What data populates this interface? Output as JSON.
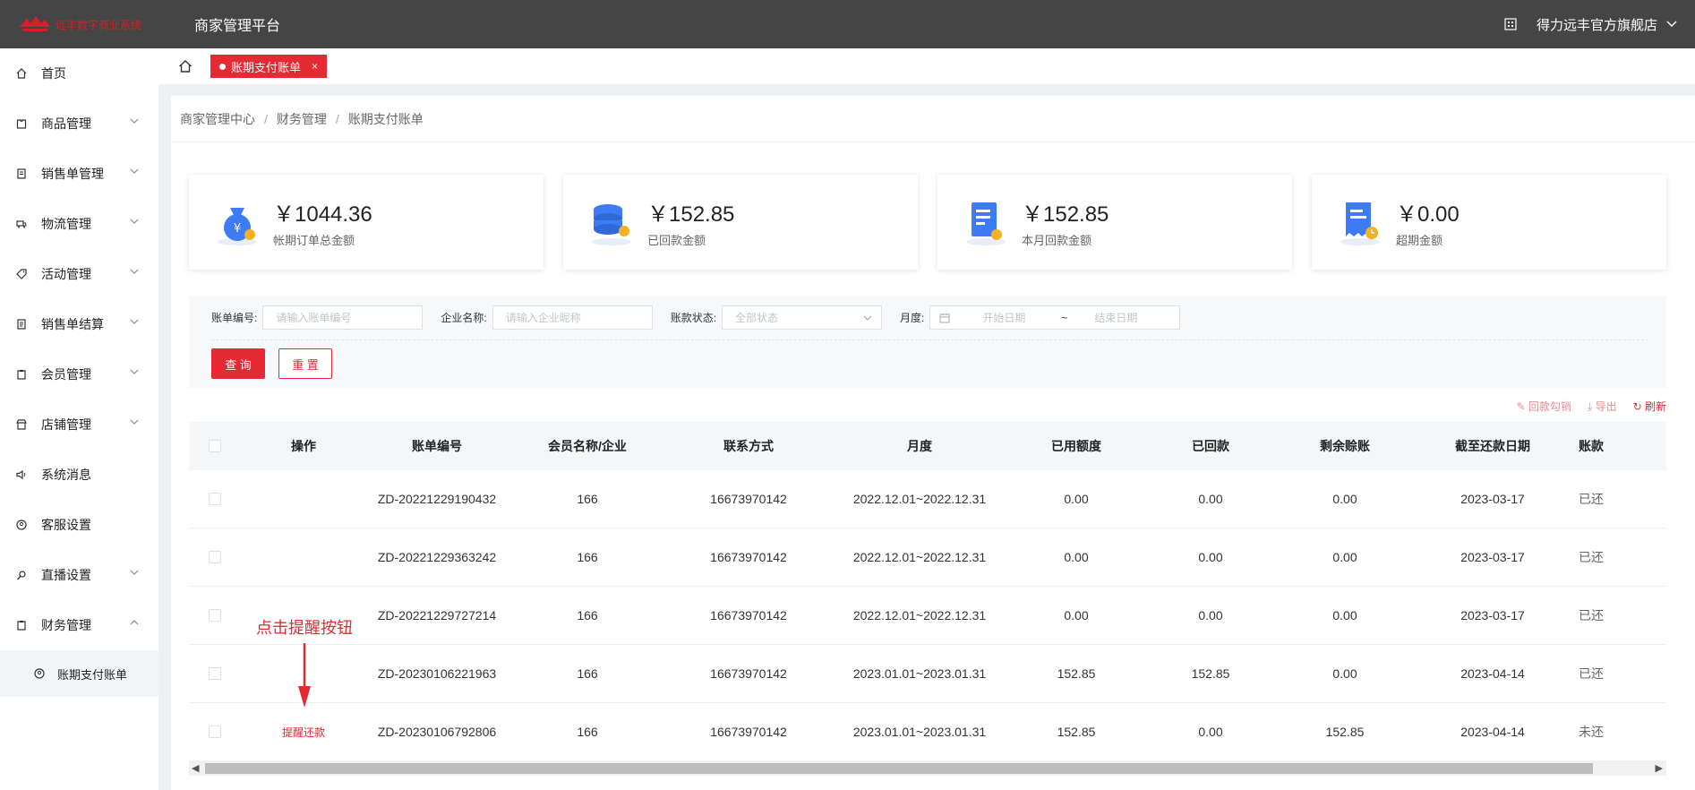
{
  "header": {
    "logo_text": "远丰数字商业系统",
    "platform_title": "商家管理平台",
    "store_name": "得力远丰官方旗舰店"
  },
  "sidebar": {
    "items": [
      {
        "label": "首页",
        "icon": "home-icon"
      },
      {
        "label": "商品管理",
        "icon": "goods-icon"
      },
      {
        "label": "销售单管理",
        "icon": "order-icon"
      },
      {
        "label": "物流管理",
        "icon": "truck-icon"
      },
      {
        "label": "活动管理",
        "icon": "tag-icon"
      },
      {
        "label": "销售单结算",
        "icon": "settle-icon"
      },
      {
        "label": "会员管理",
        "icon": "member-icon"
      },
      {
        "label": "店铺管理",
        "icon": "shop-icon"
      },
      {
        "label": "系统消息",
        "icon": "speaker-icon"
      },
      {
        "label": "客服设置",
        "icon": "service-icon"
      },
      {
        "label": "直播设置",
        "icon": "live-icon"
      },
      {
        "label": "财务管理",
        "icon": "finance-icon"
      }
    ],
    "sub_item": "账期支付账单"
  },
  "tabs": {
    "active_label": "账期支付账单",
    "close": "×"
  },
  "breadcrumb": [
    "商家管理中心",
    "财务管理",
    "账期支付账单"
  ],
  "breadcrumb_sep": "/",
  "stats": [
    {
      "value": "￥1044.36",
      "label": "帐期订单总金额",
      "icon": "money-bag-icon"
    },
    {
      "value": "￥152.85",
      "label": "已回款金额",
      "icon": "coin-stack-icon"
    },
    {
      "value": "￥152.85",
      "label": "本月回款金额",
      "icon": "document-icon"
    },
    {
      "value": "￥0.00",
      "label": "超期金额",
      "icon": "receipt-icon"
    }
  ],
  "filter": {
    "bill_no_label": "账单编号:",
    "bill_no_placeholder": "请输入账单编号",
    "company_label": "企业名称:",
    "company_placeholder": "请输入企业昵称",
    "status_label": "账款状态:",
    "status_value": "全部状态",
    "month_label": "月度:",
    "start_placeholder": "开始日期",
    "range_sep": "~",
    "end_placeholder": "结束日期",
    "query": "查 询",
    "reset": "重 置"
  },
  "tools": {
    "writeoff": "回款勾销",
    "export": "导出",
    "refresh": "刷新"
  },
  "table": {
    "headers": [
      "操作",
      "账单编号",
      "会员名称/企业",
      "联系方式",
      "月度",
      "已用额度",
      "已回款",
      "剩余赊账",
      "截至还款日期",
      "账款"
    ],
    "rows": [
      {
        "action": "",
        "bill_no": "ZD-20221229190432",
        "member": "166",
        "contact": "16673970142",
        "month": "2022.12.01~2022.12.31",
        "used": "0.00",
        "repaid": "0.00",
        "remaining": "0.00",
        "due": "2023-03-17",
        "status": "已还"
      },
      {
        "action": "",
        "bill_no": "ZD-20221229363242",
        "member": "166",
        "contact": "16673970142",
        "month": "2022.12.01~2022.12.31",
        "used": "0.00",
        "repaid": "0.00",
        "remaining": "0.00",
        "due": "2023-03-17",
        "status": "已还"
      },
      {
        "action": "",
        "bill_no": "ZD-20221229727214",
        "member": "166",
        "contact": "16673970142",
        "month": "2022.12.01~2022.12.31",
        "used": "0.00",
        "repaid": "0.00",
        "remaining": "0.00",
        "due": "2023-03-17",
        "status": "已还"
      },
      {
        "action": "",
        "bill_no": "ZD-20230106221963",
        "member": "166",
        "contact": "16673970142",
        "month": "2023.01.01~2023.01.31",
        "used": "152.85",
        "repaid": "152.85",
        "remaining": "0.00",
        "due": "2023-04-14",
        "status": "已还"
      },
      {
        "action": "提醒还款",
        "bill_no": "ZD-20230106792806",
        "member": "166",
        "contact": "16673970142",
        "month": "2023.01.01~2023.01.31",
        "used": "152.85",
        "repaid": "0.00",
        "remaining": "152.85",
        "due": "2023-04-14",
        "status": "未还"
      }
    ]
  },
  "annotation": "点击提醒按钮",
  "colors": {
    "brand": "#e52a33",
    "header_bg": "#454545",
    "icon_blue": "#3d7cf4",
    "icon_gold": "#f5b122"
  }
}
